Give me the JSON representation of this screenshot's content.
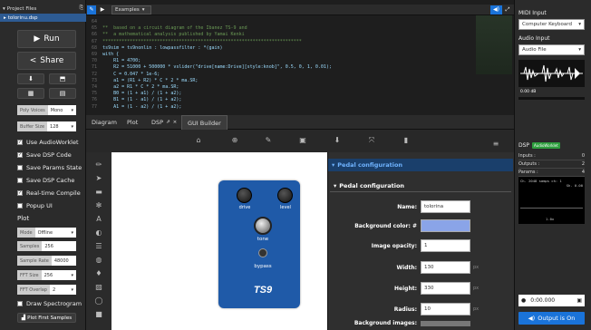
{
  "left": {
    "header": "Project Files",
    "file": "tolorinu.dsp",
    "run_label": "Run",
    "share_label": "Share",
    "poly_label": "Poly Voices",
    "poly_value": "Mono",
    "buffer_label": "Buffer Size",
    "buffer_value": "128",
    "checks": [
      "Use AudioWorklet",
      "Save DSP Code",
      "Save Params State",
      "Save DSP Cache",
      "Real-time Compile",
      "Popup UI"
    ],
    "plot_title": "Plot",
    "mode_label": "Mode",
    "mode_value": "Offline",
    "samples_label": "Samples",
    "samples_value": "256",
    "rate_label": "Sample Rate",
    "rate_value": "48000",
    "fft_label": "FFT Size",
    "fft_value": "256",
    "overlap_label": "FFT Overlap",
    "overlap_value": "2",
    "spectrogram_label": "Draw Spectrogram",
    "plot_first_label": "Plot First Samples"
  },
  "editor": {
    "examples_label": "Examples",
    "lines": [
      {
        "n": "64",
        "t": " "
      },
      {
        "n": "65",
        "t": "**  based on a circuit diagram of the Ibanez TS-9 and"
      },
      {
        "n": "66",
        "t": "**  a mathematical analysis published by Yamai Kenki"
      },
      {
        "n": "67",
        "t": "*************************************************************************"
      },
      {
        "n": "68",
        "t": "ts9sim = ts9nonlin : lowpassfilter : *(gain)"
      },
      {
        "n": "69",
        "t": "with {"
      },
      {
        "n": "70",
        "t": "    R1 = 4700;"
      },
      {
        "n": "71",
        "t": "    R2 = 51000 + 500000 * vslider(\"drive[name:Drive][style:knob]\", 0.5, 0, 1, 0.01);"
      },
      {
        "n": "72",
        "t": "    C = 0.047 * 1e-6;"
      },
      {
        "n": "73",
        "t": "    a1 = (R1 + R2) * C * 2 * ma.SR;"
      },
      {
        "n": "74",
        "t": "    a2 = R1 * C * 2 * ma.SR;"
      },
      {
        "n": "75",
        "t": "    B0 = (1 + a1) / (1 + a2);"
      },
      {
        "n": "76",
        "t": "    B1 = (1 - a1) / (1 + a2);"
      },
      {
        "n": "77",
        "t": "    A1 = (1 - a2) / (1 + a2);"
      }
    ]
  },
  "tabs": {
    "diagram": "Diagram",
    "plot": "Plot",
    "dsp": "DSP",
    "gui": "GUI Builder"
  },
  "pedal": {
    "drive_label": "drive",
    "level_label": "level",
    "tone_label": "tone",
    "bypass_label": "bypass",
    "logo": "TS9",
    "color": "#1f5aa8"
  },
  "panel": {
    "outer_title": "Pedal configuration",
    "inner_title": "Pedal configuration",
    "name_label": "Name:",
    "name_value": "tolorina",
    "bg_label": "Background color: #",
    "bg_color": "#8aa4e8",
    "opacity_label": "Image opacity:",
    "opacity_value": "1",
    "width_label": "Width:",
    "width_value": "130",
    "height_label": "Height:",
    "height_value": "330",
    "radius_label": "Radius:",
    "radius_value": "10",
    "bgimages_label": "Background images:",
    "unit": "px"
  },
  "right": {
    "midi_title": "MIDI Input",
    "midi_value": "Computer Keyboard",
    "audio_title": "Audio Input",
    "audio_value": "Audio File",
    "db_value": "0.00 dB",
    "dsp_title": "DSP",
    "dsp_badge": "AudioWorklet",
    "inputs_label": "Inputs :",
    "inputs_value": "0",
    "outputs_label": "Outputs :",
    "outputs_value": "2",
    "params_label": "Params :",
    "params_value": "4",
    "scope_text1": "Ch. 2048 samps  ch: 1",
    "scope_text2": "Sh. 0.00",
    "scope_text3": "1.0x",
    "time_value": "0:00.000",
    "output_label": "Output is On"
  }
}
